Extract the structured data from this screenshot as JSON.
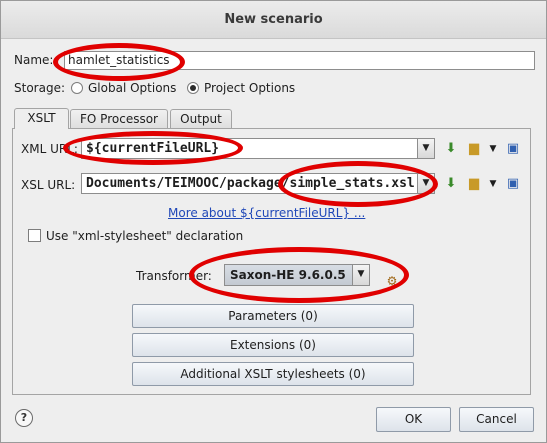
{
  "dialog": {
    "title": "New scenario",
    "name_label": "Name:",
    "name_value": "hamlet_statistics",
    "storage_label": "Storage:",
    "storage_options": [
      "Global Options",
      "Project Options"
    ],
    "storage_selected": "Project Options"
  },
  "tabs": [
    "XSLT",
    "FO Processor",
    "Output"
  ],
  "xslt": {
    "xml_url_label": "XML URL:",
    "xml_url_value": "${currentFileURL}",
    "xsl_url_label": "XSL URL:",
    "xsl_url_value": "Documents/TEIMOOC/package/simple_stats.xsl",
    "more_link": "More about ${currentFileURL} ...",
    "checkbox_label": "Use \"xml-stylesheet\" declaration",
    "checkbox_checked": false,
    "transformer_label": "Transformer:",
    "transformer_value": "Saxon-HE 9.6.0.5",
    "buttons": [
      "Parameters (0)",
      "Extensions (0)",
      "Additional XSLT stylesheets (0)"
    ]
  },
  "footer": {
    "ok_label": "OK",
    "cancel_label": "Cancel",
    "help_icon": "?"
  },
  "colors": {
    "highlight": "#e00000",
    "link": "#2048b8"
  }
}
